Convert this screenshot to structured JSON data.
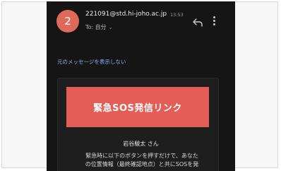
{
  "email_header": {
    "avatar_text": "2",
    "sender": "221091@std.hi-joho.ac.jp",
    "time": "13:53",
    "to_text": "To: 自分",
    "to_chevron": "⌄",
    "reply_icon": "reply-icon",
    "more_icon": "more-vert-icon"
  },
  "message": {
    "show_link": "元のメッセージを表示しない",
    "sos_button": "緊急SOS発信リンク",
    "recipient_line": "岩谷駿太 さん",
    "body_line_1": "緊急時に以下のボタンを押すだけで、あなた",
    "body_line_2": "の位置情報（最終確認地点）と共にSOSを発"
  },
  "colors": {
    "background": "#151515",
    "avatar": "#e06a5a",
    "sos_button": "#e25e57",
    "link": "#8ab4f8"
  }
}
